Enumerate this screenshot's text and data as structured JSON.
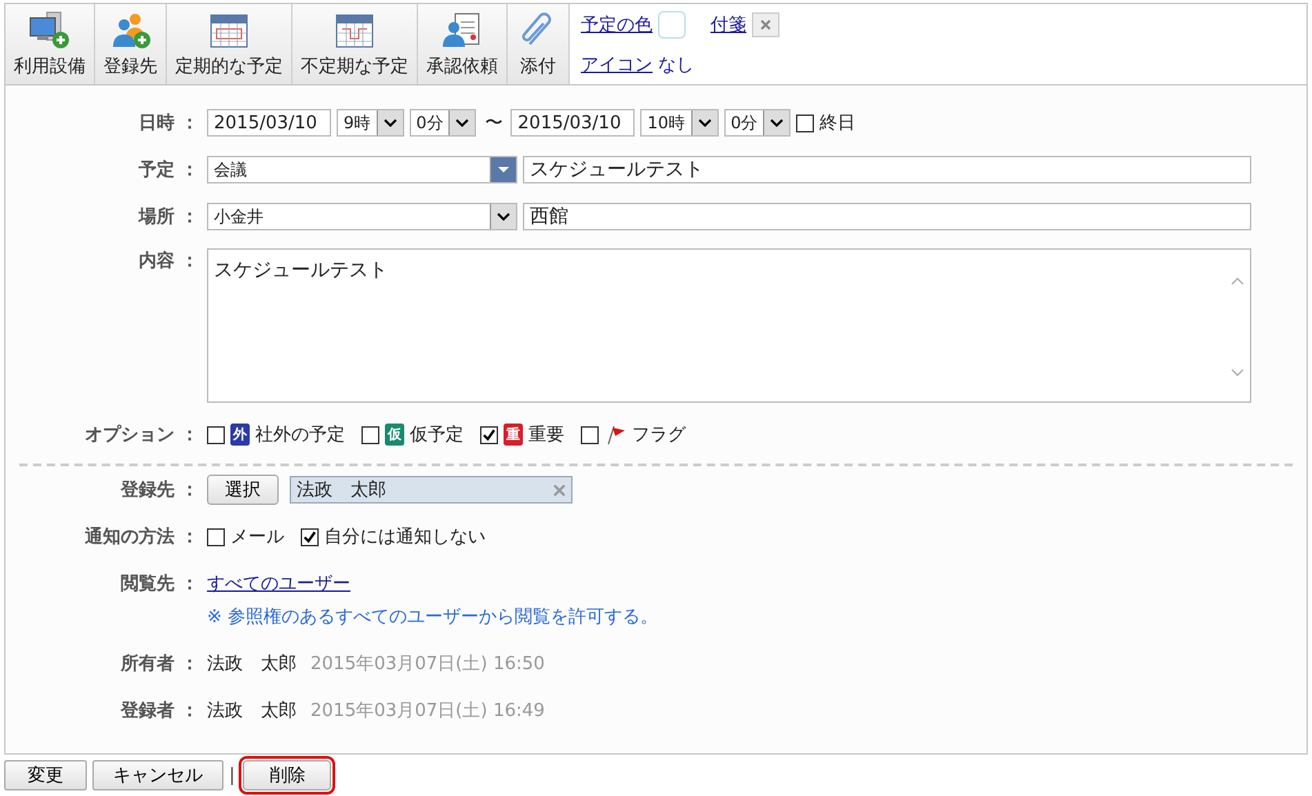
{
  "toolbar": {
    "buttons": [
      {
        "label": "利用設備",
        "kind": "equipment"
      },
      {
        "label": "登録先",
        "kind": "people"
      },
      {
        "label": "定期的な予定",
        "kind": "calendar-regular"
      },
      {
        "label": "不定期な予定",
        "kind": "calendar-irregular"
      },
      {
        "label": "承認依頼",
        "kind": "approval"
      },
      {
        "label": "添付",
        "kind": "clip"
      }
    ],
    "color_link": "予定の色",
    "tag_link": "付箋",
    "icon_link": "アイコン",
    "icon_value": "なし"
  },
  "form": {
    "datetime": {
      "label": "日時 ：",
      "start_date": "2015/03/10",
      "start_hour": "9時",
      "start_minute": "0分",
      "tilde": "〜",
      "end_date": "2015/03/10",
      "end_hour": "10時",
      "end_minute": "0分",
      "all_day": {
        "label": "終日",
        "checked": false
      }
    },
    "schedule": {
      "label": "予定 ：",
      "category": "会議",
      "title": "スケジュールテスト"
    },
    "place": {
      "label": "場所 ：",
      "location": "小金井",
      "detail": "西館"
    },
    "content": {
      "label": "内容 ：",
      "text": "スケジュールテスト"
    },
    "options": {
      "label": "オプション ：",
      "items": [
        {
          "kind": "badge",
          "badge": "外",
          "color": "#2b3aa8",
          "label": "社外の予定",
          "checked": false
        },
        {
          "kind": "badge",
          "badge": "仮",
          "color": "#1a8a6e",
          "label": "仮予定",
          "checked": false
        },
        {
          "kind": "badge",
          "badge": "重",
          "color": "#d81e2a",
          "label": "重要",
          "checked": true
        },
        {
          "kind": "flag",
          "label": "フラグ",
          "checked": false
        }
      ]
    },
    "registrant": {
      "label": "登録先 ：",
      "select_button": "選択",
      "chip": "法政　太郎"
    },
    "notify": {
      "label": "通知の方法 ：",
      "items": [
        {
          "label": "メール",
          "checked": false
        },
        {
          "label": "自分には通知しない",
          "checked": true
        }
      ]
    },
    "viewers": {
      "label": "閲覧先 ：",
      "link": "すべてのユーザー",
      "note": "※ 参照権のあるすべてのユーザーから閲覧を許可する。"
    },
    "owner": {
      "label": "所有者 ：",
      "name": "法政　太郎",
      "time": "2015年03月07日(土) 16:50"
    },
    "creator": {
      "label": "登録者 ：",
      "name": "法政　太郎",
      "time": "2015年03月07日(土) 16:49"
    }
  },
  "footer": {
    "buttons": [
      {
        "label": "変更",
        "highlighted": false
      },
      {
        "label": "キャンセル",
        "highlighted": false,
        "separator": "|"
      },
      {
        "label": "削除",
        "highlighted": true
      }
    ]
  }
}
